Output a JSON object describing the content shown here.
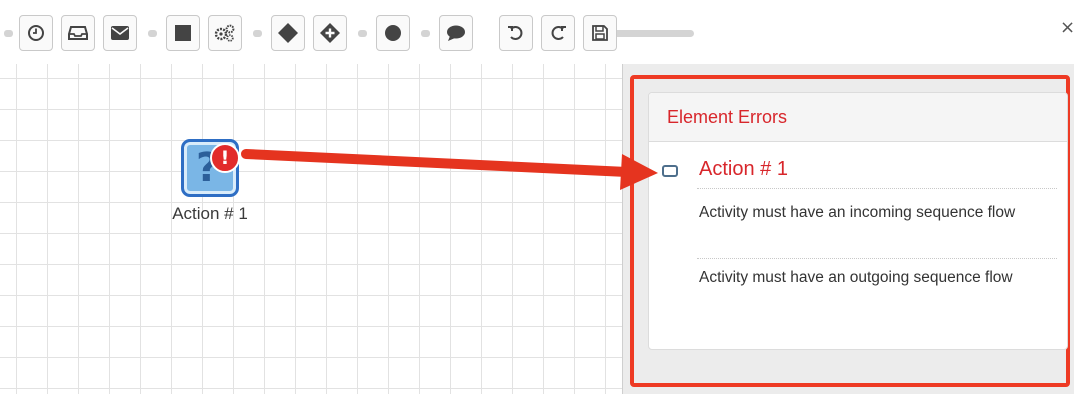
{
  "toolbar": {
    "buttons": [
      {
        "name": "clock-icon"
      },
      {
        "name": "inbox-icon"
      },
      {
        "name": "envelope-icon"
      },
      {
        "name": "square-icon"
      },
      {
        "name": "gears-icon"
      },
      {
        "name": "diamond-icon"
      },
      {
        "name": "diamond-plus-icon"
      },
      {
        "name": "circle-icon"
      },
      {
        "name": "speech-bubble-icon"
      },
      {
        "name": "undo-icon"
      },
      {
        "name": "redo-icon"
      },
      {
        "name": "save-icon"
      }
    ],
    "close_label": "×"
  },
  "canvas": {
    "node": {
      "label": "Action # 1",
      "icon": "question-icon",
      "error_badge": "!"
    }
  },
  "panel": {
    "title": "Element Errors",
    "errors": [
      {
        "element": "Action # 1",
        "messages": [
          "Activity must have an incoming sequence flow",
          "Activity must have an outgoing sequence flow"
        ]
      }
    ]
  },
  "colors": {
    "error_red": "#d8262b",
    "highlight_red": "#ee3a24",
    "node_blue": "#7ab6e6",
    "node_border": "#2e6ec4"
  }
}
